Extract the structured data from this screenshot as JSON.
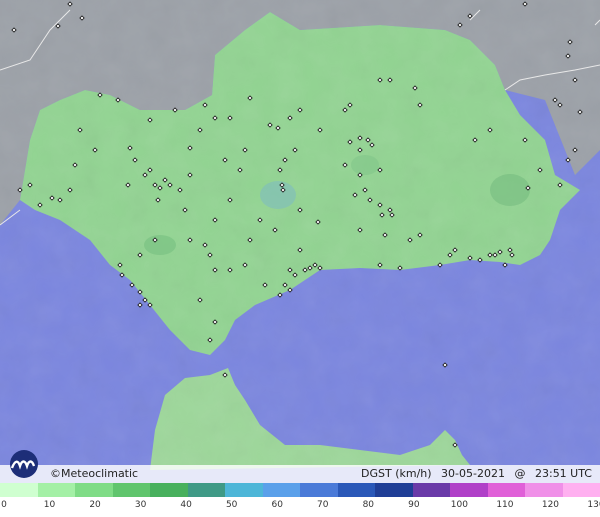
{
  "brand": {
    "name": "©Meteoclimatic",
    "logo": "meteoclimatic-logo-icon"
  },
  "caption": {
    "variable": "DGST (km/h)",
    "date": "30-05-2021",
    "at": "@",
    "time": "23:51 UTC"
  },
  "legend": {
    "ticks": [
      "0",
      "10",
      "20",
      "30",
      "40",
      "50",
      "60",
      "70",
      "80",
      "90",
      "100",
      "110",
      "120",
      "130"
    ],
    "colors": [
      "#cfffd0",
      "#a4f0a6",
      "#7fdc86",
      "#60c56d",
      "#48b05d",
      "#3f9a86",
      "#4db6d8",
      "#5aa0ea",
      "#4a7ad8",
      "#2a58b8",
      "#1f3e96",
      "#6a3aa8",
      "#b040c8",
      "#e060d8",
      "#f090e8",
      "#ffb0f0"
    ]
  },
  "colors": {
    "sea": "#7b86df",
    "land_foreign": "#9aa0a8",
    "region": "#92d492"
  },
  "stations": {
    "count_visible": 150,
    "icon": "station-marker-icon"
  }
}
